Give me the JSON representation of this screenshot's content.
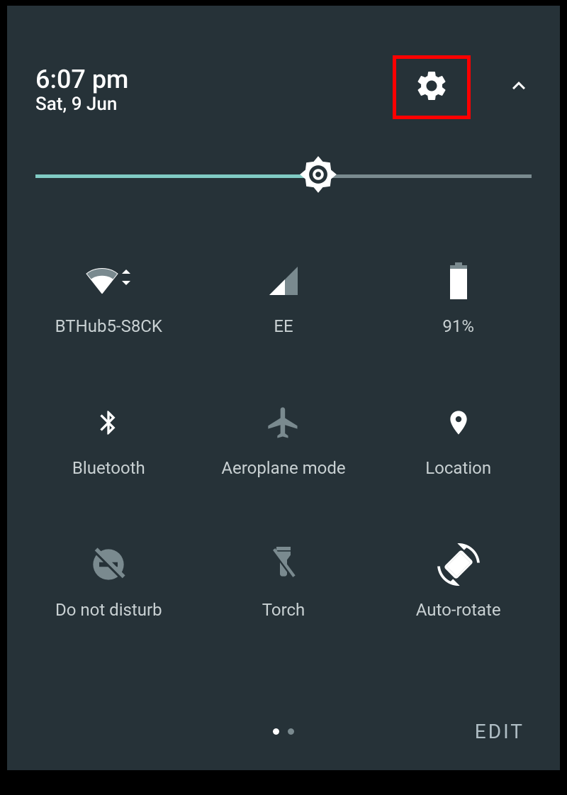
{
  "header": {
    "time": "6:07 pm",
    "date": "Sat, 9 Jun"
  },
  "brightness": {
    "percent": 57
  },
  "tiles": [
    {
      "id": "wifi",
      "label": "BTHub5-S8CK",
      "active": true
    },
    {
      "id": "cellular",
      "label": "EE",
      "active": true
    },
    {
      "id": "battery",
      "label": "91%",
      "active": true
    },
    {
      "id": "bluetooth",
      "label": "Bluetooth",
      "active": true
    },
    {
      "id": "airplane",
      "label": "Aeroplane mode",
      "active": false
    },
    {
      "id": "location",
      "label": "Location",
      "active": true
    },
    {
      "id": "dnd",
      "label": "Do not disturb",
      "active": false
    },
    {
      "id": "torch",
      "label": "Torch",
      "active": false
    },
    {
      "id": "autorotate",
      "label": "Auto-rotate",
      "active": true
    }
  ],
  "footer": {
    "edit_label": "EDIT",
    "page_current": 1,
    "page_total": 2
  },
  "colors": {
    "panel_bg": "#263238",
    "accent": "#80cbc4",
    "inactive": "#7a8a8f",
    "highlight_border": "#ff0000"
  }
}
